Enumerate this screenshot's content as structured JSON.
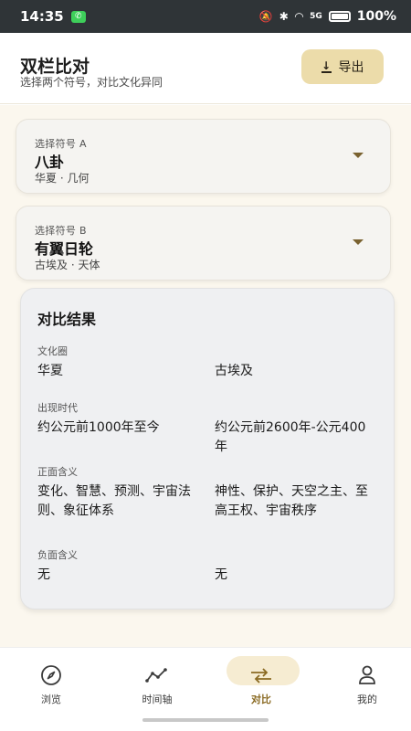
{
  "status_bar": {
    "time": "14:35",
    "battery": "100%",
    "signal_label": "5G"
  },
  "header": {
    "title": "双栏比对",
    "subtitle": "选择两个符号，对比文化异同",
    "export_label": "导出"
  },
  "selector_a": {
    "label": "选择符号 A",
    "value": "八卦",
    "meta": "华夏 · 几何"
  },
  "selector_b": {
    "label": "选择符号 B",
    "value": "有翼日轮",
    "meta": "古埃及 · 天体"
  },
  "results": {
    "title": "对比结果",
    "rows": [
      {
        "label": "文化圈",
        "a": "华夏",
        "b": "古埃及"
      },
      {
        "label": "出现时代",
        "a": "约公元前1000年至今",
        "b": "约公元前2600年-公元400年"
      },
      {
        "label": "正面含义",
        "a": "变化、智慧、预测、宇宙法则、象征体系",
        "b": "神性、保护、天空之主、至高王权、宇宙秩序"
      },
      {
        "label": "负面含义",
        "a": "无",
        "b": "无"
      }
    ]
  },
  "nav": {
    "items": [
      {
        "label": "浏览",
        "icon": "compass-icon"
      },
      {
        "label": "时间轴",
        "icon": "timeline-icon"
      },
      {
        "label": "对比",
        "icon": "compare-icon"
      },
      {
        "label": "我的",
        "icon": "person-icon"
      }
    ],
    "active_color": "#8a6a22"
  },
  "colors": {
    "accent": "#ecdcaa",
    "page_bg": "#fbf7ee",
    "card_bg": "#f5f4f1"
  }
}
